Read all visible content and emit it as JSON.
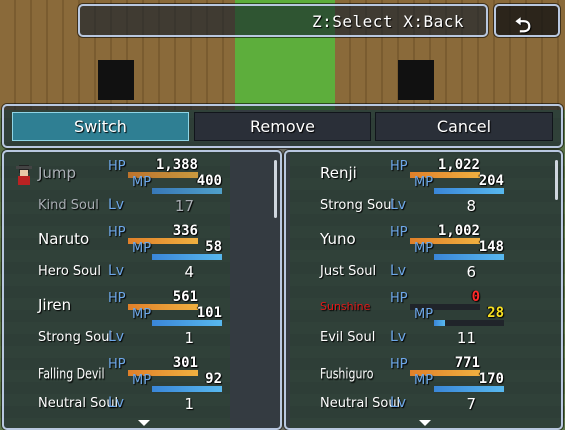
{
  "help": {
    "text": "Z:Select X:Back"
  },
  "back_button": {
    "icon": "return-arrow-icon"
  },
  "commands": [
    {
      "label": "Switch",
      "selected": true
    },
    {
      "label": "Remove",
      "selected": false
    },
    {
      "label": "Cancel",
      "selected": false
    }
  ],
  "labels": {
    "hp": "HP",
    "mp": "MP",
    "lv": "Lv"
  },
  "left_members": [
    {
      "name": "Jump",
      "soul": "Kind Soul",
      "hp": "1,388",
      "hp_ratio": 1.0,
      "mp": "400",
      "mp_ratio": 1.0,
      "lv": "17"
    },
    {
      "name": "Naruto",
      "soul": "Hero Soul",
      "hp": "336",
      "hp_ratio": 1.0,
      "mp": "58",
      "mp_ratio": 1.0,
      "lv": "4"
    },
    {
      "name": "Jiren",
      "soul": "Strong Soul",
      "hp": "561",
      "hp_ratio": 1.0,
      "mp": "101",
      "mp_ratio": 1.0,
      "lv": "1"
    },
    {
      "name": "Falling Devil",
      "soul": "Neutral Soul",
      "hp": "301",
      "hp_ratio": 1.0,
      "mp": "92",
      "mp_ratio": 1.0,
      "lv": "1"
    }
  ],
  "right_members": [
    {
      "name": "Renji",
      "soul": "Strong Soul",
      "hp": "1,022",
      "hp_ratio": 1.0,
      "mp": "204",
      "mp_ratio": 1.0,
      "lv": "8"
    },
    {
      "name": "Yuno",
      "soul": "Just Soul",
      "hp": "1,002",
      "hp_ratio": 1.0,
      "mp": "148",
      "mp_ratio": 1.0,
      "lv": "6"
    },
    {
      "name": "Sunshine",
      "soul": "Evil Soul",
      "hp": "0",
      "hp_ratio": 0.0,
      "mp": "28",
      "mp_ratio": 0.15,
      "lv": "11"
    },
    {
      "name": "Fushiguro",
      "soul": "Neutral Soul",
      "hp": "771",
      "hp_ratio": 1.0,
      "mp": "170",
      "mp_ratio": 1.0,
      "lv": "7"
    }
  ],
  "colors": {
    "selected_command": "#2f7f93",
    "hp_fill": "#f0b040",
    "mp_fill": "#58b8ee",
    "dead_name": "#e01818",
    "low_mp": "#f8e020",
    "stat_label": "#6ea7e8"
  }
}
